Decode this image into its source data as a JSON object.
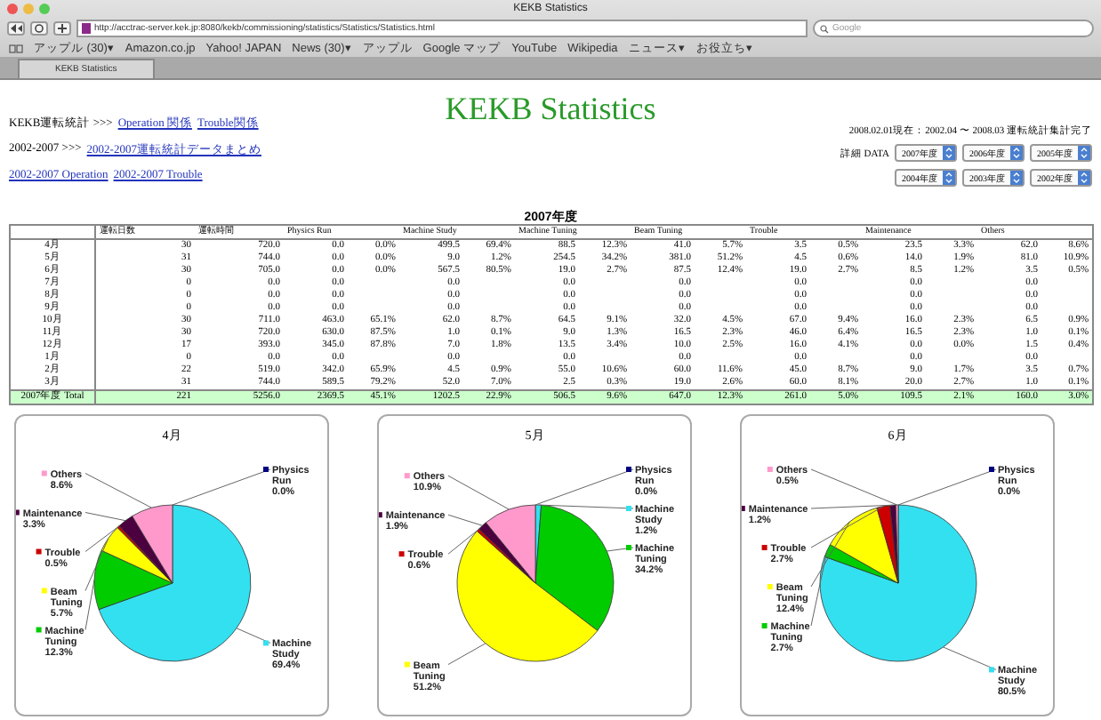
{
  "browser": {
    "window_title": "KEKB Statistics",
    "url": "http://acctrac-server.kek.jp:8080/kekb/commissioning/statistics/Statistics/Statistics.html",
    "search_placeholder": "Google",
    "bookmarks": [
      "アップル (30)▾",
      "Amazon.co.jp",
      "Yahoo! JAPAN",
      "News (30)▾",
      "アップル",
      "Google マップ",
      "YouTube",
      "Wikipedia",
      "ニュース▾",
      "お役立ち▾"
    ],
    "tabs": [
      {
        "label": "KEKB Statistics",
        "selected": true
      }
    ]
  },
  "page": {
    "title": "KEKB Statistics",
    "nav": [
      [
        {
          "kind": "text",
          "text": "KEKB運転統計 >>>"
        },
        {
          "kind": "link",
          "text": "Operation 関係"
        },
        {
          "kind": "link",
          "text": "Trouble関係"
        }
      ],
      [
        {
          "kind": "text",
          "text": "2002-2007 >>>"
        },
        {
          "kind": "link",
          "text": "2002-2007運転統計データまとめ"
        }
      ],
      [
        {
          "kind": "link",
          "text": "2002-2007 Operation"
        },
        {
          "kind": "link",
          "text": "2002-2007 Trouble"
        }
      ]
    ],
    "status": "2008.02.01現在：2002.04 〜 2008.03 運転統計集計完了",
    "detail_label": "詳細 DATA",
    "selects": [
      "2007年度",
      "2006年度",
      "2005年度",
      "2004年度",
      "2003年度",
      "2002年度"
    ]
  },
  "table": {
    "title": "2007年度",
    "columns": [
      "運転日数",
      "運転時間"
    ],
    "categories": [
      "Physics Run",
      "Machine Study",
      "Machine Tuning",
      "Beam Tuning",
      "Trouble",
      "Maintenance",
      "Others"
    ],
    "rows": [
      {
        "kind": "month",
        "label": "4月",
        "days": "30",
        "hours": "720.0",
        "stats": [
          [
            "0.0",
            "0.0%"
          ],
          [
            "499.5",
            "69.4%"
          ],
          [
            "88.5",
            "12.3%"
          ],
          [
            "41.0",
            "5.7%"
          ],
          [
            "3.5",
            "0.5%"
          ],
          [
            "23.5",
            "3.3%"
          ],
          [
            "62.0",
            "8.6%"
          ]
        ]
      },
      {
        "kind": "month",
        "label": "5月",
        "days": "31",
        "hours": "744.0",
        "stats": [
          [
            "0.0",
            "0.0%"
          ],
          [
            "9.0",
            "1.2%"
          ],
          [
            "254.5",
            "34.2%"
          ],
          [
            "381.0",
            "51.2%"
          ],
          [
            "4.5",
            "0.6%"
          ],
          [
            "14.0",
            "1.9%"
          ],
          [
            "81.0",
            "10.9%"
          ]
        ]
      },
      {
        "kind": "month",
        "label": "6月",
        "days": "30",
        "hours": "705.0",
        "stats": [
          [
            "0.0",
            "0.0%"
          ],
          [
            "567.5",
            "80.5%"
          ],
          [
            "19.0",
            "2.7%"
          ],
          [
            "87.5",
            "12.4%"
          ],
          [
            "19.0",
            "2.7%"
          ],
          [
            "8.5",
            "1.2%"
          ],
          [
            "3.5",
            "0.5%"
          ]
        ]
      },
      {
        "kind": "month",
        "label": "7月",
        "days": "0",
        "hours": "0.0",
        "stats": [
          [
            "0.0"
          ],
          [
            "0.0"
          ],
          [
            "0.0"
          ],
          [
            "0.0"
          ],
          [
            "0.0"
          ],
          [
            "0.0"
          ],
          [
            "0.0"
          ]
        ]
      },
      {
        "kind": "month",
        "label": "8月",
        "days": "0",
        "hours": "0.0",
        "stats": [
          [
            "0.0"
          ],
          [
            "0.0"
          ],
          [
            "0.0"
          ],
          [
            "0.0"
          ],
          [
            "0.0"
          ],
          [
            "0.0"
          ],
          [
            "0.0"
          ]
        ]
      },
      {
        "kind": "month",
        "label": "9月",
        "days": "0",
        "hours": "0.0",
        "stats": [
          [
            "0.0"
          ],
          [
            "0.0"
          ],
          [
            "0.0"
          ],
          [
            "0.0"
          ],
          [
            "0.0"
          ],
          [
            "0.0"
          ],
          [
            "0.0"
          ]
        ]
      },
      {
        "kind": "month",
        "label": "10月",
        "days": "30",
        "hours": "711.0",
        "stats": [
          [
            "463.0",
            "65.1%"
          ],
          [
            "62.0",
            "8.7%"
          ],
          [
            "64.5",
            "9.1%"
          ],
          [
            "32.0",
            "4.5%"
          ],
          [
            "67.0",
            "9.4%"
          ],
          [
            "16.0",
            "2.3%"
          ],
          [
            "6.5",
            "0.9%"
          ]
        ]
      },
      {
        "kind": "month",
        "label": "11月",
        "days": "30",
        "hours": "720.0",
        "stats": [
          [
            "630.0",
            "87.5%"
          ],
          [
            "1.0",
            "0.1%"
          ],
          [
            "9.0",
            "1.3%"
          ],
          [
            "16.5",
            "2.3%"
          ],
          [
            "46.0",
            "6.4%"
          ],
          [
            "16.5",
            "2.3%"
          ],
          [
            "1.0",
            "0.1%"
          ]
        ]
      },
      {
        "kind": "month",
        "label": "12月",
        "days": "17",
        "hours": "393.0",
        "stats": [
          [
            "345.0",
            "87.8%"
          ],
          [
            "7.0",
            "1.8%"
          ],
          [
            "13.5",
            "3.4%"
          ],
          [
            "10.0",
            "2.5%"
          ],
          [
            "16.0",
            "4.1%"
          ],
          [
            "0.0",
            "0.0%"
          ],
          [
            "1.5",
            "0.4%"
          ]
        ]
      },
      {
        "kind": "month",
        "label": "1月",
        "days": "0",
        "hours": "0.0",
        "stats": [
          [
            "0.0"
          ],
          [
            "0.0"
          ],
          [
            "0.0"
          ],
          [
            "0.0"
          ],
          [
            "0.0"
          ],
          [
            "0.0"
          ],
          [
            "0.0"
          ]
        ]
      },
      {
        "kind": "month",
        "label": "2月",
        "days": "22",
        "hours": "519.0",
        "stats": [
          [
            "342.0",
            "65.9%"
          ],
          [
            "4.5",
            "0.9%"
          ],
          [
            "55.0",
            "10.6%"
          ],
          [
            "60.0",
            "11.6%"
          ],
          [
            "45.0",
            "8.7%"
          ],
          [
            "9.0",
            "1.7%"
          ],
          [
            "3.5",
            "0.7%"
          ]
        ]
      },
      {
        "kind": "month",
        "label": "3月",
        "days": "31",
        "hours": "744.0",
        "stats": [
          [
            "589.5",
            "79.2%"
          ],
          [
            "52.0",
            "7.0%"
          ],
          [
            "2.5",
            "0.3%"
          ],
          [
            "19.0",
            "2.6%"
          ],
          [
            "60.0",
            "8.1%"
          ],
          [
            "20.0",
            "2.7%"
          ],
          [
            "1.0",
            "0.1%"
          ]
        ]
      },
      {
        "kind": "total",
        "label": "2007年度 Total",
        "days": "221",
        "hours": "5256.0",
        "stats": [
          [
            "2369.5",
            "45.1%"
          ],
          [
            "1202.5",
            "22.9%"
          ],
          [
            "506.5",
            "9.6%"
          ],
          [
            "647.0",
            "12.3%"
          ],
          [
            "261.0",
            "5.0%"
          ],
          [
            "109.5",
            "2.1%"
          ],
          [
            "160.0",
            "3.0%"
          ]
        ]
      }
    ]
  },
  "charts": [
    {
      "chart_data": {
        "type": "pie",
        "title": "4月",
        "categories": [
          "Physics Run",
          "Machine Study",
          "Machine Tuning",
          "Beam Tuning",
          "Trouble",
          "Maintenance",
          "Others"
        ],
        "values": [
          0.0,
          69.4,
          12.3,
          5.7,
          0.5,
          3.3,
          8.6
        ],
        "colors": [
          "#000080",
          "#33e0f0",
          "#00cc00",
          "#ffff00",
          "#cc0000",
          "#4b0040",
          "#ff99cc"
        ],
        "value_labels": [
          "0.0%",
          "69.4%",
          "12.3%",
          "5.7%",
          "0.5%",
          "3.3%",
          "8.6%"
        ],
        "legend": true
      }
    },
    {
      "chart_data": {
        "type": "pie",
        "title": "5月",
        "categories": [
          "Physics Run",
          "Machine Study",
          "Machine Tuning",
          "Beam Tuning",
          "Trouble",
          "Maintenance",
          "Others"
        ],
        "values": [
          0.0,
          1.2,
          34.2,
          51.2,
          0.6,
          1.9,
          10.9
        ],
        "colors": [
          "#000080",
          "#33e0f0",
          "#00cc00",
          "#ffff00",
          "#cc0000",
          "#4b0040",
          "#ff99cc"
        ],
        "value_labels": [
          "0.0%",
          "1.2%",
          "34.2%",
          "51.2%",
          "0.6%",
          "1.9%",
          "10.9%"
        ],
        "legend": true
      }
    },
    {
      "chart_data": {
        "type": "pie",
        "title": "6月",
        "categories": [
          "Physics Run",
          "Machine Study",
          "Machine Tuning",
          "Beam Tuning",
          "Trouble",
          "Maintenance",
          "Others"
        ],
        "values": [
          0.0,
          80.5,
          2.7,
          12.4,
          2.7,
          1.2,
          0.5
        ],
        "colors": [
          "#000080",
          "#33e0f0",
          "#00cc00",
          "#ffff00",
          "#cc0000",
          "#4b0040",
          "#ff99cc"
        ],
        "value_labels": [
          "0.0%",
          "80.5%",
          "2.7%",
          "12.4%",
          "2.7%",
          "1.2%",
          "0.5%"
        ],
        "legend": true
      }
    }
  ]
}
